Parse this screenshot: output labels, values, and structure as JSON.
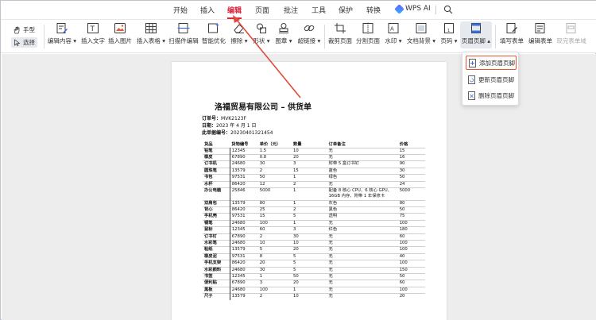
{
  "menu": {
    "items": [
      "开始",
      "插入",
      "编辑",
      "页面",
      "批注",
      "工具",
      "保护",
      "转换"
    ],
    "active": "编辑",
    "ai_label": "WPS AI",
    "accent_color": "#d9263c"
  },
  "toolbar": {
    "hand_label": "手型",
    "select_label": "选择",
    "tools": [
      {
        "label": "编辑内容",
        "icon": "edit-content-icon",
        "dropdown": true
      },
      {
        "label": "插入文字",
        "icon": "insert-text-icon"
      },
      {
        "label": "插入图片",
        "icon": "insert-image-icon"
      },
      {
        "label": "插入表格",
        "icon": "insert-table-icon",
        "dropdown": true
      },
      {
        "label": "扫描件编辑",
        "icon": "scan-edit-icon"
      },
      {
        "label": "智能优化",
        "icon": "smart-optimize-icon"
      },
      {
        "label": "擦除",
        "icon": "eraser-icon",
        "dropdown": true
      },
      {
        "label": "形状",
        "icon": "shape-icon",
        "dropdown": true
      },
      {
        "label": "图章",
        "icon": "stamp-icon",
        "dropdown": true
      },
      {
        "label": "超链接",
        "icon": "hyperlink-icon",
        "dropdown": true
      },
      {
        "label": "裁剪页面",
        "icon": "crop-page-icon"
      },
      {
        "label": "分割页面",
        "icon": "split-page-icon"
      },
      {
        "label": "水印",
        "icon": "watermark-icon",
        "dropdown": true
      },
      {
        "label": "文档背景",
        "icon": "background-icon",
        "dropdown": true
      },
      {
        "label": "页码",
        "icon": "page-number-icon",
        "dropdown": true
      },
      {
        "label": "页眉页脚",
        "icon": "header-footer-icon",
        "dropdown": true
      },
      {
        "label": "填写表单",
        "icon": "fill-form-icon"
      },
      {
        "label": "编辑表单",
        "icon": "edit-form-icon"
      },
      {
        "label": "现完表单域",
        "icon": "form-field-icon",
        "disabled": true
      }
    ]
  },
  "dropdown": {
    "items": [
      "添加页眉页脚",
      "更新页眉页脚",
      "删除页眉页脚"
    ],
    "highlight_color": "#e8542f"
  },
  "document": {
    "title": "洛福贸易有限公司 – 供货单",
    "order_label": "订单号：",
    "order_value": "MVK2123F",
    "date_label": "日期：",
    "date_value": "2023 年 4 月 1 日",
    "ref_label": "此单据编号：",
    "ref_value": "20230401321454",
    "table": {
      "headers": [
        "货品",
        "货物编号",
        "单价（元）",
        "数量",
        "订单备注",
        "价格"
      ],
      "rows": [
        [
          "铅笔",
          "12345",
          "1.5",
          "10",
          "无",
          "15"
        ],
        [
          "橡皮",
          "67890",
          "0.8",
          "20",
          "无",
          "16"
        ],
        [
          "订书机",
          "24680",
          "30",
          "3",
          "附带 5 盒订书钉",
          "90"
        ],
        [
          "圆珠笔",
          "13579",
          "2",
          "15",
          "蓝色",
          "30"
        ],
        [
          "书包",
          "97531",
          "50",
          "1",
          "绿色",
          "50"
        ],
        [
          "水杯",
          "86420",
          "12",
          "2",
          "无",
          "24"
        ],
        [
          "办公电脑",
          "25846",
          "5000",
          "1",
          "配备 8 核心 CPU、6 核心 GPU、16GB 内存、附带 1 年保修卡",
          "5000"
        ],
        [
          "双肩包",
          "13579",
          "80",
          "1",
          "灰色",
          "80"
        ],
        [
          "背心",
          "86420",
          "25",
          "2",
          "黑色",
          "50"
        ],
        [
          "手机壳",
          "97531",
          "15",
          "5",
          "透明",
          "75"
        ],
        [
          "钢笔",
          "24680",
          "100",
          "1",
          "无",
          "100"
        ],
        [
          "鼠标",
          "12345",
          "60",
          "3",
          "红色",
          "180"
        ],
        [
          "订书钉",
          "67890",
          "2",
          "30",
          "无",
          "60"
        ],
        [
          "水彩笔",
          "24680",
          "10",
          "10",
          "无",
          "100"
        ],
        [
          "粘纸",
          "13579",
          "5",
          "20",
          "无",
          "100"
        ],
        [
          "橡皮泥",
          "97531",
          "8",
          "5",
          "无",
          "40"
        ],
        [
          "手机支架",
          "86420",
          "20",
          "5",
          "无",
          "100"
        ],
        [
          "水彩颜料",
          "24680",
          "30",
          "5",
          "无",
          "150"
        ],
        [
          "书签",
          "12345",
          "1",
          "50",
          "无",
          "50"
        ],
        [
          "便利贴",
          "67890",
          "3",
          "20",
          "无",
          "60"
        ],
        [
          "黑板",
          "24680",
          "100",
          "1",
          "无",
          "100"
        ],
        [
          "尺子",
          "13579",
          "2",
          "10",
          "无",
          "20"
        ]
      ]
    }
  }
}
